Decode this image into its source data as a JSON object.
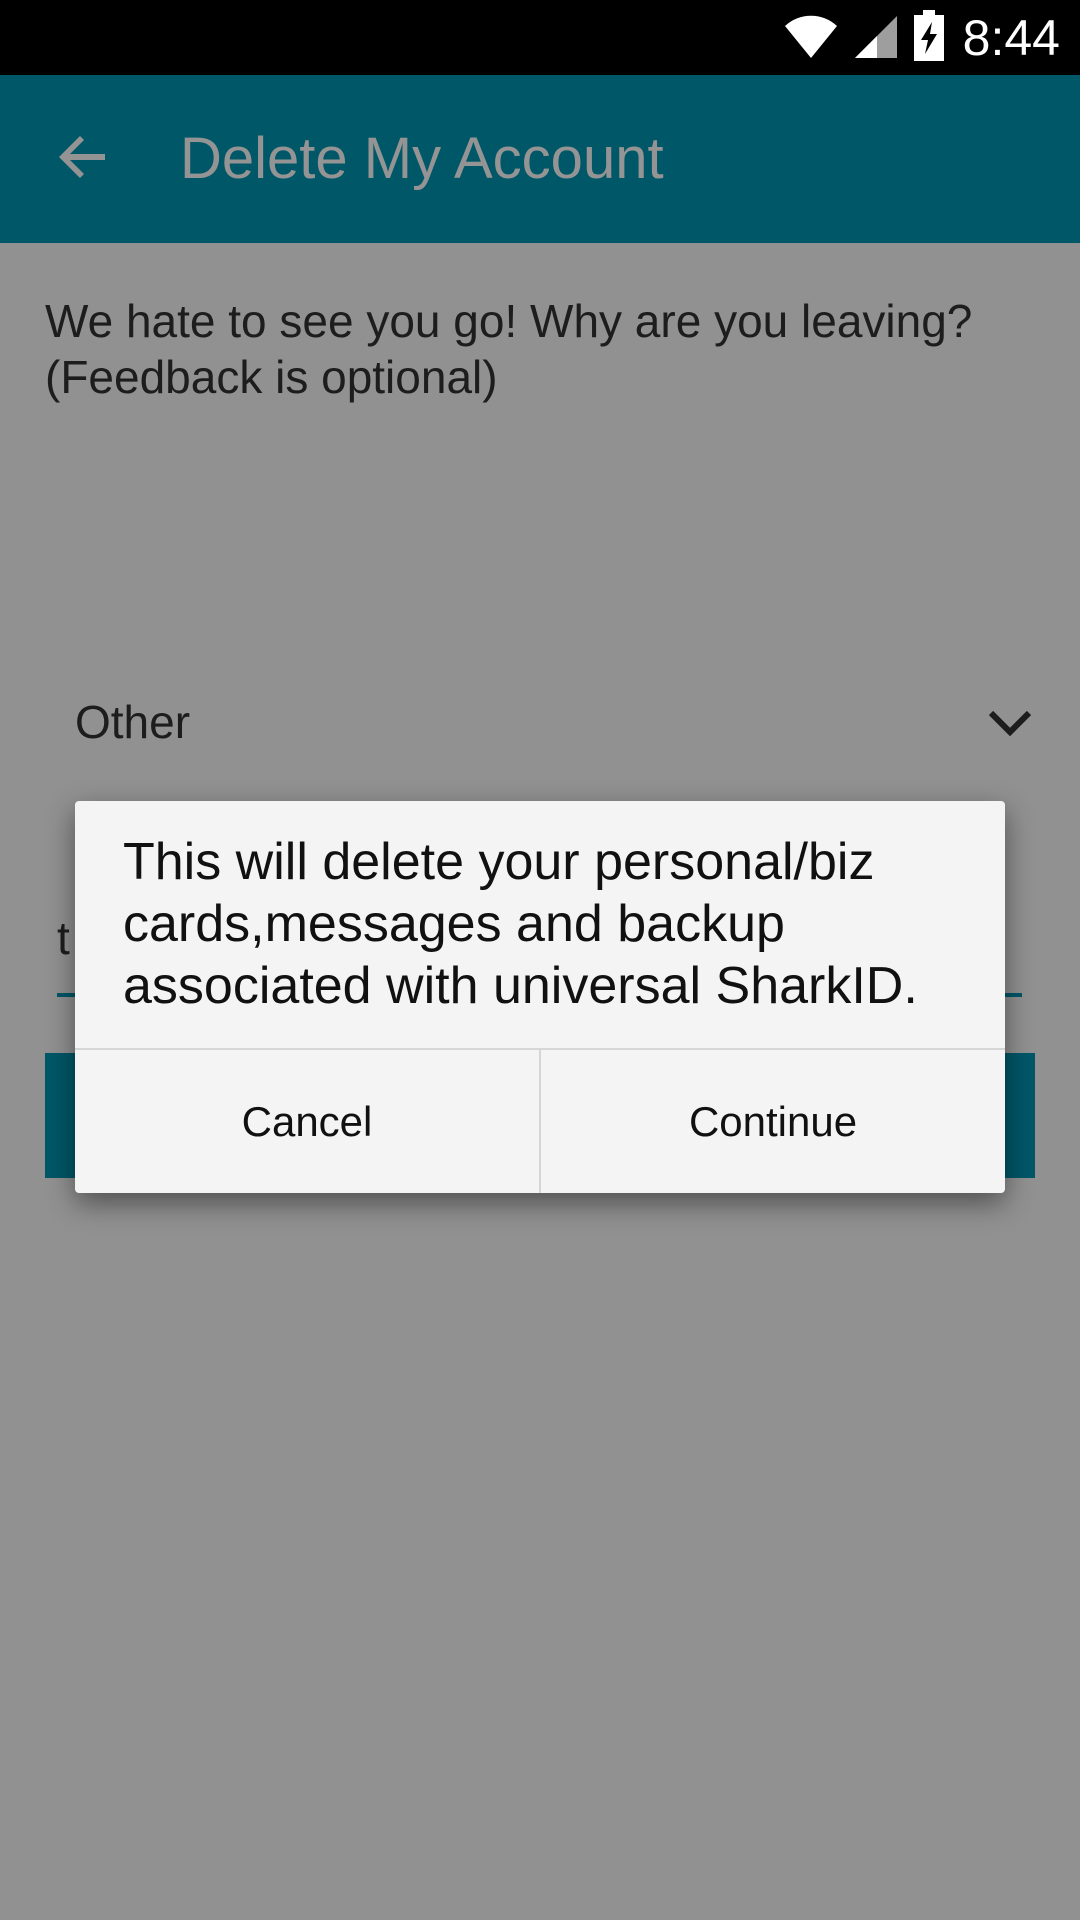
{
  "status_bar": {
    "time": "8:44",
    "icons": [
      "wifi-icon",
      "signal-icon",
      "battery-charging-icon"
    ]
  },
  "app_bar": {
    "title": "Delete My Account",
    "back_icon": "arrow-back-icon",
    "background": "#0096b3"
  },
  "content": {
    "prompt": "We hate to see you go! Why are you leaving? (Feedback is optional)",
    "reason_select": {
      "value": "Other",
      "icon": "chevron-down-icon"
    },
    "feedback_input": {
      "value": "t"
    }
  },
  "dialog": {
    "message": "This will delete your personal/biz cards,messages and backup associated with universal SharkID.",
    "cancel_label": "Cancel",
    "continue_label": "Continue"
  },
  "colors": {
    "accent": "#0096b3",
    "scrim": "rgba(0,0,0,0.42)",
    "dialog_bg": "#f4f4f4"
  }
}
